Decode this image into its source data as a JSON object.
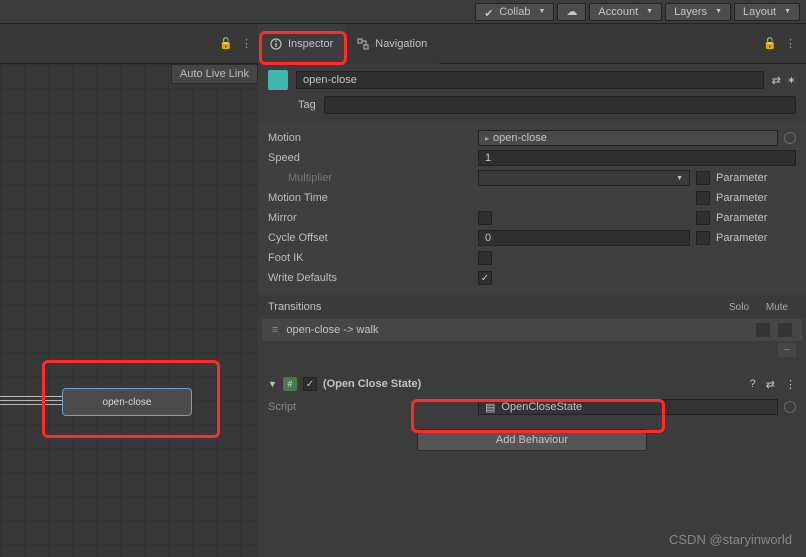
{
  "toolbar": {
    "collab": "Collab",
    "account": "Account",
    "layers": "Layers",
    "layout": "Layout"
  },
  "tabs": {
    "inspector": "Inspector",
    "navigation": "Navigation"
  },
  "leftPanel": {
    "autoLiveLink": "Auto Live Link",
    "nodeName": "open-close"
  },
  "state": {
    "name": "open-close",
    "tagLabel": "Tag"
  },
  "props": {
    "motionLabel": "Motion",
    "motionValue": "open-close",
    "speedLabel": "Speed",
    "speedValue": "1",
    "multiplierLabel": "Multiplier",
    "motionTimeLabel": "Motion Time",
    "mirrorLabel": "Mirror",
    "cycleOffsetLabel": "Cycle Offset",
    "cycleOffsetValue": "0",
    "footIKLabel": "Foot IK",
    "writeDefaultsLabel": "Write Defaults",
    "parameterLabel": "Parameter"
  },
  "transitions": {
    "header": "Transitions",
    "solo": "Solo",
    "mute": "Mute",
    "item": "open-close -> walk"
  },
  "component": {
    "title": "(Open Close State)",
    "scriptLabel": "Script",
    "scriptValue": "OpenCloseState",
    "addBehaviour": "Add Behaviour"
  },
  "watermark": "CSDN @staryinworld"
}
